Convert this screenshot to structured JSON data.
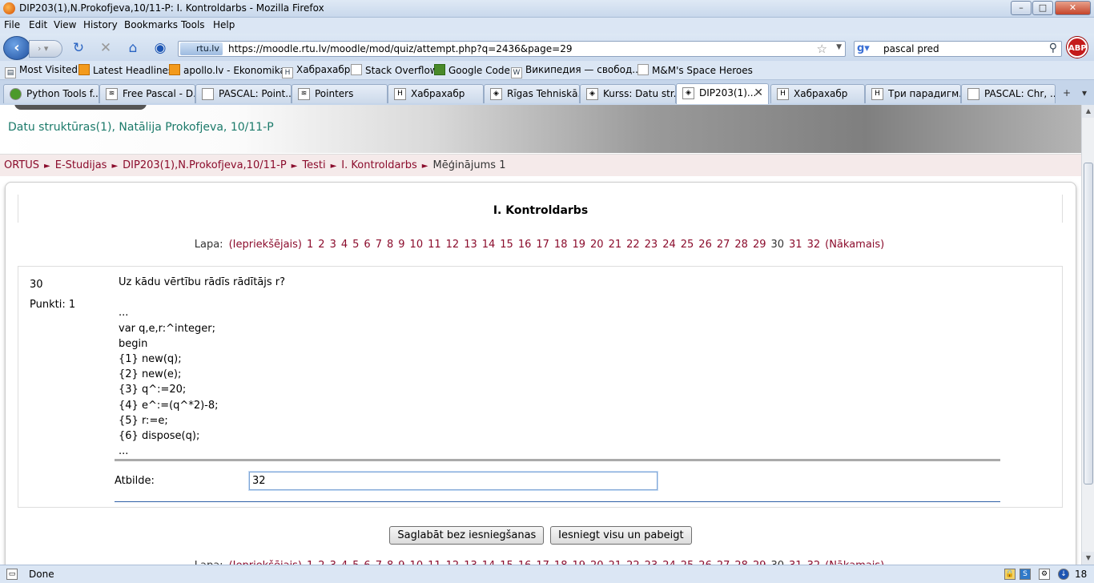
{
  "window": {
    "title": "DIP203(1),N.Prokofjeva,10/11-P: I. Kontroldarbs - Mozilla Firefox",
    "min": "–",
    "max": "□",
    "close": "✕"
  },
  "menu": [
    "File",
    "Edit",
    "View",
    "History",
    "Bookmarks",
    "Tools",
    "Help"
  ],
  "nav": {
    "site_badge": "rtu.lv",
    "url": "https://moodle.rtu.lv/moodle/mod/quiz/attempt.php?q=2436&page=29",
    "search_query": "pascal pred",
    "abp": "ABP"
  },
  "bookmarks": [
    "Most Visited",
    "Latest Headlines",
    "apollo.lv - Ekonomika",
    "Хабрахабр",
    "Stack Overflow",
    "Google Code",
    "Википедия — свобод...",
    "M&M's Space Heroes"
  ],
  "tabs": [
    {
      "label": "Python Tools f..."
    },
    {
      "label": "Free Pascal - D..."
    },
    {
      "label": "PASCAL: Point..."
    },
    {
      "label": "Pointers"
    },
    {
      "label": "Хабрахабр"
    },
    {
      "label": "Rīgas Tehniskā..."
    },
    {
      "label": "Kurss: Datu str..."
    },
    {
      "label": "DIP203(1)..."
    },
    {
      "label": "Хабрахабр"
    },
    {
      "label": "Три парадигм..."
    },
    {
      "label": "PASCAL: Chr, ..."
    }
  ],
  "page": {
    "course_title": "Datu struktūras(1), Natālija Prokofjeva, 10/11-P",
    "breadcrumb": [
      "ORTUS",
      "E-Studijas",
      "DIP203(1),N.Prokofjeva,10/11-P",
      "Testi",
      "I. Kontroldarbs"
    ],
    "breadcrumb_current": "Mēģinājums 1",
    "quiz_title": "I. Kontroldarbs",
    "pager": {
      "label": "Lapa:",
      "prev": "(Iepriekšējais)",
      "next": "(Nākamais)",
      "pages_before": [
        "1",
        "2",
        "3",
        "4",
        "5",
        "6",
        "7",
        "8",
        "9",
        "10",
        "11",
        "12",
        "13",
        "14",
        "15",
        "16",
        "17",
        "18",
        "19",
        "20",
        "21",
        "22",
        "23",
        "24",
        "25",
        "26",
        "27",
        "28",
        "29"
      ],
      "current": "30",
      "pages_after": [
        "31",
        "32"
      ]
    },
    "question": {
      "number": "30",
      "points": "Punkti: 1",
      "text": "Uz kādu vērtību rādīs rādītājs r?\n\n...\nvar q,e,r:^integer;\nbegin\n{1} new(q);\n{2} new(e);\n{3} q^:=20;\n{4} e^:=(q^*2)-8;\n{5} r:=e;\n{6} dispose(q);\n...",
      "answer_label": "Atbilde:",
      "answer_value": "32"
    },
    "buttons": {
      "save": "Saglabāt bez iesniegšanas",
      "submit": "Iesniegt visu un pabeigt"
    }
  },
  "status": {
    "text": "Done",
    "count": "18"
  }
}
